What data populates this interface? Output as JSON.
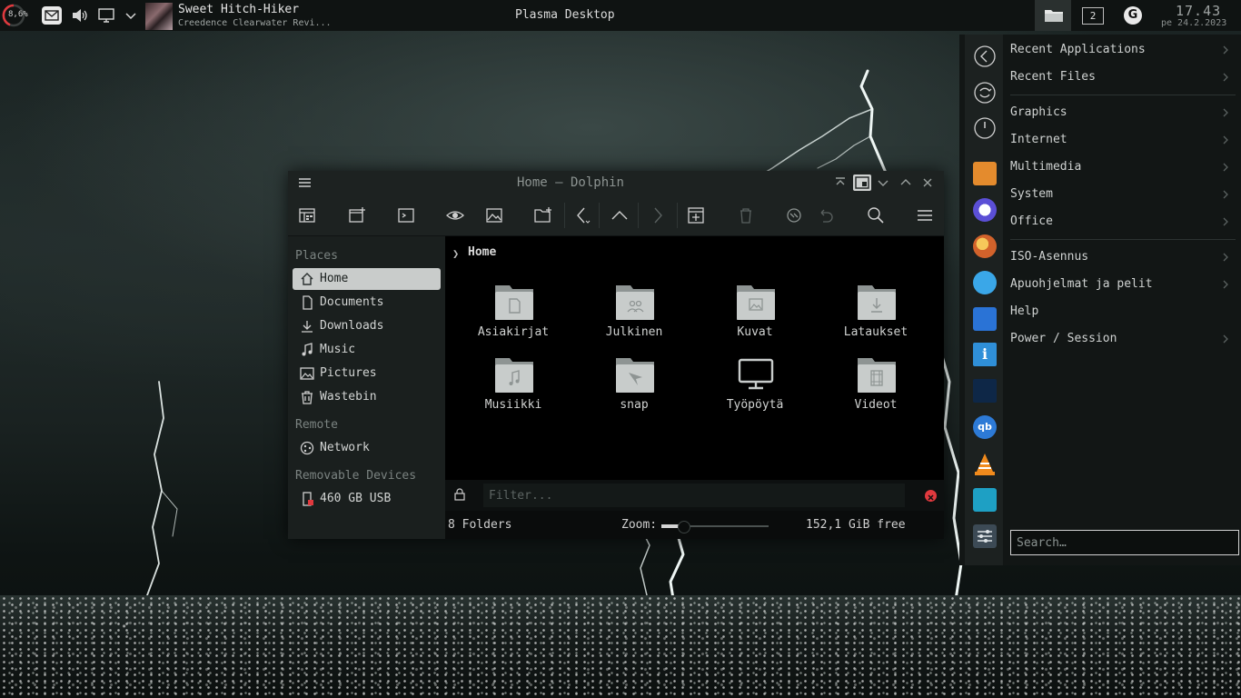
{
  "panel": {
    "cpu_load": "8,6%",
    "song_title": "Sweet Hitch-Hiker",
    "song_artist": "Creedence Clearwater Revi...",
    "window_title": "Plasma Desktop",
    "desktop_number": "2",
    "clock_time": "17.43",
    "clock_date": "pe 24.2.2023"
  },
  "dolphin": {
    "title": "Home — Dolphin",
    "sidebar": {
      "places_header": "Places",
      "places": [
        {
          "label": "Home",
          "icon": "home-icon"
        },
        {
          "label": "Documents",
          "icon": "document-icon"
        },
        {
          "label": "Downloads",
          "icon": "download-icon"
        },
        {
          "label": "Music",
          "icon": "music-icon"
        },
        {
          "label": "Pictures",
          "icon": "picture-icon"
        },
        {
          "label": "Wastebin",
          "icon": "trash-icon"
        }
      ],
      "remote_header": "Remote",
      "remote": [
        {
          "label": "Network",
          "icon": "network-icon"
        }
      ],
      "removable_header": "Removable Devices",
      "removable": [
        {
          "label": "460 GB USB",
          "icon": "usb-drive-icon"
        }
      ]
    },
    "breadcrumb": "Home",
    "folders": [
      {
        "label": "Asiakirjat",
        "icon": "folder-documents-icon"
      },
      {
        "label": "Julkinen",
        "icon": "folder-public-icon"
      },
      {
        "label": "Kuvat",
        "icon": "folder-pictures-icon"
      },
      {
        "label": "Lataukset",
        "icon": "folder-download-icon"
      },
      {
        "label": "Musiikki",
        "icon": "folder-music-icon"
      },
      {
        "label": "snap",
        "icon": "folder-snap-icon"
      },
      {
        "label": "Työpöytä",
        "icon": "desktop-monitor-icon"
      },
      {
        "label": "Videot",
        "icon": "folder-videos-icon"
      }
    ],
    "filter_placeholder": "Filter...",
    "status": {
      "count": "8 Folders",
      "zoom_label": "Zoom:",
      "zoom_level_fraction": 0.2,
      "free_space": "152,1 GiB free"
    }
  },
  "launcher": {
    "categories": [
      {
        "label": "Recent Applications"
      },
      {
        "label": "Recent Files"
      },
      {
        "label": "Graphics"
      },
      {
        "label": "Internet"
      },
      {
        "label": "Multimedia"
      },
      {
        "label": "System"
      },
      {
        "label": "Office"
      },
      {
        "label": "ISO-Asennus"
      },
      {
        "label": "Apuohjelmat ja pelit"
      },
      {
        "label": "Help"
      },
      {
        "label": "Power / Session"
      }
    ],
    "search_placeholder": "Search…"
  }
}
